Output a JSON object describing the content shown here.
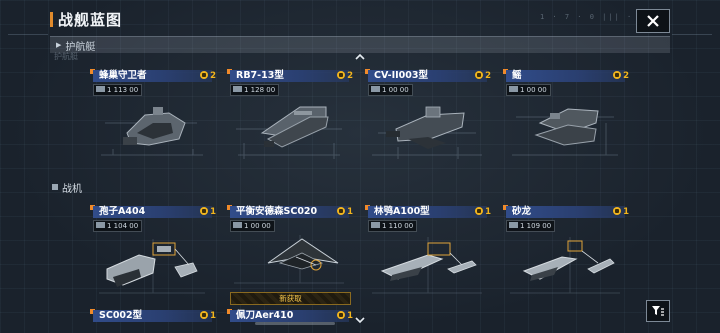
{
  "header": {
    "title": "战舰蓝图",
    "deco": "1 · 7 · 0  |||  · ·"
  },
  "filter": {
    "label": "护航艇",
    "ghost_label": "护航艇"
  },
  "sections": [
    {
      "label": "战机"
    }
  ],
  "cards": [
    {
      "name": "蜂巢守卫者",
      "count": "2",
      "meta": "1 113 00"
    },
    {
      "name": "RB7-13型",
      "count": "2",
      "meta": "1 128 00"
    },
    {
      "name": "CV-II003型",
      "count": "2",
      "meta": "1 00 00"
    },
    {
      "name": "鳐",
      "count": "2",
      "meta": "1 00 00"
    },
    {
      "name": "孢子A404",
      "count": "1",
      "meta": "1 104 00"
    },
    {
      "name": "平衡安德森SC020",
      "count": "1",
      "meta": "1 00 00",
      "new_label": "新获取"
    },
    {
      "name": "林鸮A100型",
      "count": "1",
      "meta": "1 110 00"
    },
    {
      "name": "砂龙",
      "count": "1",
      "meta": "1 109 00"
    },
    {
      "name": "SC002型",
      "count": "1",
      "meta": ""
    },
    {
      "name": "佩刀Aer410",
      "count": "1",
      "meta": ""
    }
  ],
  "colors": {
    "accent": "#f08a2a",
    "name_bar": "#314c8a",
    "badge": "#f2b51e"
  },
  "icons": {
    "close": "close-icon",
    "filter": "filter-icon",
    "scroll_up": "chevron-up-icon",
    "scroll_down": "chevron-down-icon"
  }
}
